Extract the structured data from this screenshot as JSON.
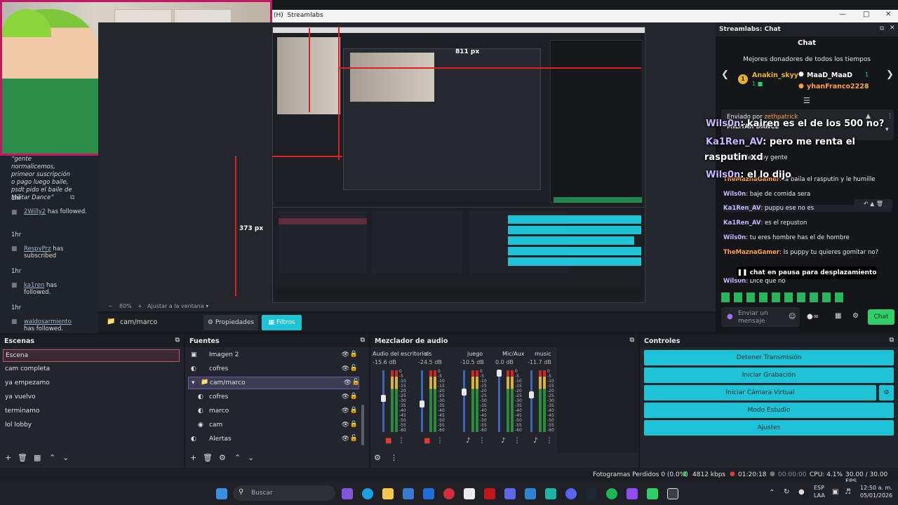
{
  "window": {
    "title": "Streamlabs",
    "prefix": "(H)"
  },
  "webcam_overlay": {
    "frame_color": "#c41566"
  },
  "events": {
    "items": [
      {
        "quote": "“gente normalicemos, primeor suscripción o pago luego baile, psdt pido el baile de Militar Dance”",
        "time": "1hr"
      },
      {
        "name": "2Willy2",
        "action": "has followed.",
        "time": "1hr"
      },
      {
        "name": "RespyPrz",
        "action": "has subscribed",
        "time": "1hr"
      },
      {
        "name": "ka1ren",
        "action": "has followed.",
        "time": "1hr"
      },
      {
        "name": "waldosarmiento",
        "action": "has followed.",
        "time": ""
      }
    ]
  },
  "preview": {
    "px_label_top": "811 px",
    "px_label_side": "373 px",
    "zoom": "80%",
    "fit": "Ajustar a la ventana"
  },
  "source_bar": {
    "source": "cam/marco",
    "properties": "Propiedades",
    "filters": "Filtros"
  },
  "chat": {
    "panel_title": "Streamlabs: Chat",
    "title": "Chat",
    "donors_title": "Mejores donadores de todos los tiempos",
    "donors": [
      {
        "name": "Anakin_skyy",
        "rank": "1"
      },
      {
        "name": "MaaD_MaaD",
        "value": "1"
      },
      {
        "name": "yhanFranco2228",
        "value": "1"
      }
    ],
    "sent_by_label": "Enviado por",
    "sent_by_user": "zethpatrick",
    "pinned_text": "MILITAR DANCE",
    "overlay_lines": [
      {
        "user": "Wils0n",
        "text": ": kairen es el de los 500 no?"
      },
      {
        "user": "Ka1Ren_AV",
        "text": ": pero me renta el"
      },
      {
        "user": "",
        "text": "rasputin xd"
      },
      {
        "user": "Wils0n",
        "text": ": el lo dijo"
      }
    ],
    "messages": [
      {
        "user": "",
        "text": "r: baje de pupy gente"
      },
      {
        "user": "TheMaznaGamer",
        "text": ": la baila el rasputin y le humille"
      },
      {
        "user": "Wils0n",
        "text": ": baje de comida sera"
      },
      {
        "user": "Ka1Ren_AV",
        "text": ": puppu ese no es"
      },
      {
        "user": "Ka1Ren_AV",
        "text": ": es el repuston"
      },
      {
        "user": "Wils0n",
        "text": ": tu eres hombre has el de hombre"
      },
      {
        "user": "TheMaznaGamer",
        "text": ": Is puppy tu quieres gomitar no?"
      },
      {
        "user": "Wils0n",
        "text": ": Dice que no"
      }
    ],
    "paused_banner": "chat en pausa para desplazamiento",
    "input_placeholder": "Enviar un mensaje",
    "send_label": "Chat"
  },
  "scenes": {
    "title": "Escenas",
    "items": [
      "Escena",
      "cam completa",
      "ya empezamo",
      "ya vuelvo",
      "terminamo",
      "lol lobby"
    ],
    "selected": "Escena"
  },
  "sources": {
    "title": "Fuentes",
    "items": [
      {
        "label": "Imagen 2",
        "icon": "image-icon",
        "indent": 0
      },
      {
        "label": "cofres",
        "icon": "browser-icon",
        "indent": 0
      },
      {
        "label": "cam/marco",
        "icon": "folder-icon",
        "indent": 0
      },
      {
        "label": "cofres",
        "icon": "browser-icon",
        "indent": 1
      },
      {
        "label": "marco",
        "icon": "browser-icon",
        "indent": 1
      },
      {
        "label": "cam",
        "icon": "camera-icon",
        "indent": 1
      },
      {
        "label": "Alertas",
        "icon": "browser-icon",
        "indent": 0
      }
    ]
  },
  "mixer": {
    "title": "Mezclador de audio",
    "channels": [
      {
        "name": "Audio del escritorio",
        "db": "-15.6 dB",
        "fader_level": 0.55,
        "muted": true
      },
      {
        "name": "ds",
        "db": "-24.5 dB",
        "fader_level": 0.45,
        "muted": true
      },
      {
        "name": "juego",
        "db": "-10.5 dB",
        "fader_level": 0.65,
        "muted": false
      },
      {
        "name": "Mic/Aux",
        "db": "0.0 dB",
        "fader_level": 0.95,
        "muted": false
      },
      {
        "name": "music",
        "db": "-11.7 dB",
        "fader_level": 0.6,
        "muted": false
      }
    ],
    "scale": [
      "0",
      "-5",
      "-10",
      "-15",
      "-20",
      "-25",
      "-30",
      "-35",
      "-40",
      "-45",
      "-50",
      "-55",
      "-60"
    ]
  },
  "controls": {
    "title": "Controles",
    "buttons": [
      "Detener Transmisión",
      "Iniciar Grabación",
      "Iniciar Cámara Virtual",
      "Modo Estudio",
      "Ajustes"
    ]
  },
  "status": {
    "dropped": "Fotogramas Perdidos 0 (0.0%)",
    "bitrate": "4812 kbps",
    "live_time": "01:20:18",
    "rec_time": "00:00:00",
    "cpu": "CPU: 4.1%",
    "fps": "30.00 / 30.00 FPS"
  },
  "taskbar": {
    "search_placeholder": "Buscar",
    "lang": "ESP",
    "lang2": "LAA",
    "time": "12:50 a. m.",
    "date": "05/01/2026"
  },
  "colors": {
    "accent": "#1ec3d6",
    "selected_scene_border": "#c0506a",
    "live": "#2fd06a"
  }
}
